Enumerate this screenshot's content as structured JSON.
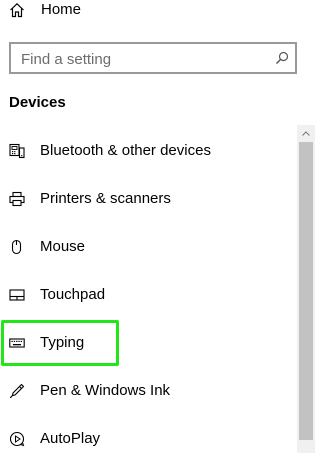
{
  "home": {
    "label": "Home",
    "icon": "home-icon"
  },
  "search": {
    "placeholder": "Find a setting",
    "value": "",
    "icon": "search-icon"
  },
  "section": {
    "title": "Devices"
  },
  "nav": {
    "items": [
      {
        "label": "Bluetooth & other devices",
        "icon": "bluetooth-devices-icon"
      },
      {
        "label": "Printers & scanners",
        "icon": "printer-icon"
      },
      {
        "label": "Mouse",
        "icon": "mouse-icon"
      },
      {
        "label": "Touchpad",
        "icon": "touchpad-icon"
      },
      {
        "label": "Typing",
        "icon": "keyboard-icon"
      },
      {
        "label": "Pen & Windows Ink",
        "icon": "pen-icon"
      },
      {
        "label": "AutoPlay",
        "icon": "autoplay-icon"
      }
    ]
  },
  "colors": {
    "highlight": "#22e51a",
    "search_border": "#999999",
    "scrollbar_thumb": "#c2c2c2",
    "scrollbar_track": "#f0f0f0"
  }
}
